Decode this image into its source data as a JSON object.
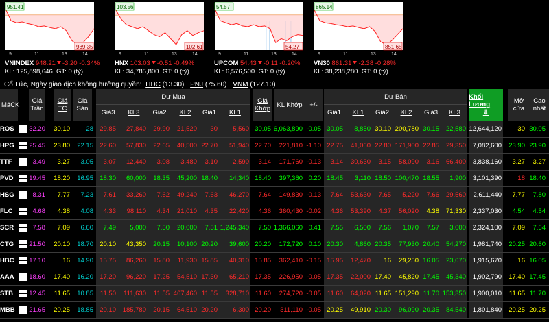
{
  "colors": {
    "up": "#00ff00",
    "down": "#ff2b2b",
    "ref": "#ffff00",
    "ceil": "#ff40ff",
    "floor": "#00cccc",
    "white": "#ffffff"
  },
  "indices": [
    {
      "name": "VNINDEX",
      "value": "948.21",
      "change": "-3.20",
      "pct": "-0.34%",
      "kl_label": "KL:",
      "kl": "125,898,646",
      "gt_label": "GT:",
      "gt": "0 (tỷ)",
      "high_label": "951.41",
      "low_label": "939.35",
      "xticks": [
        "9",
        "11",
        "13",
        "14"
      ]
    },
    {
      "name": "HNX",
      "value": "103.03",
      "change": "-0.51",
      "pct": "-0.49%",
      "kl_label": "KL:",
      "kl": "34,785,800",
      "gt_label": "GT:",
      "gt": "0 (tỷ)",
      "high_label": "103.56",
      "low_label": "102.61",
      "xticks": [
        "9",
        "11",
        "13",
        "14"
      ]
    },
    {
      "name": "UPCOM",
      "value": "54.43",
      "change": "-0.11",
      "pct": "-0.20%",
      "kl_label": "KL:",
      "kl": "6,576,500",
      "gt_label": "GT:",
      "gt": "0 (tỷ)",
      "high_label": "54.57",
      "low_label": "54.27",
      "xticks": [
        "9",
        "11",
        "13",
        "14"
      ]
    },
    {
      "name": "VN30",
      "value": "861.31",
      "change": "-2.38",
      "pct": "-0.28%",
      "kl_label": "KL:",
      "kl": "38,238,280",
      "gt_label": "GT:",
      "gt": "0 (tỷ)",
      "high_label": "865.14",
      "low_label": "851.65",
      "xticks": [
        "9",
        "11",
        "13",
        "14"
      ]
    }
  ],
  "dividend": {
    "text": "Cổ Tức, Ngày giao dịch không hưởng quyền:",
    "items": [
      {
        "code": "HDC",
        "val": "(13.30)"
      },
      {
        "code": "PNJ",
        "val": "(75.60)"
      },
      {
        "code": "VNM",
        "val": "(127.10)"
      }
    ]
  },
  "headers": {
    "mack": "MãCK",
    "tran": "Giá Trần",
    "tc": "Giá TC",
    "san": "Giá Sàn",
    "du_mua": "Dư Mua",
    "du_ban": "Dư Bán",
    "gia3": "Giá3",
    "kl3": "KL3",
    "gia2": "Giá2",
    "kl2": "KL2",
    "gia1": "Giá1",
    "kl1": "KL1",
    "gia_khop": "Giá Khớp",
    "kl_khop": "KL Khớp",
    "pm": "+/-",
    "khoi_luong": "Khối Lương",
    "sort": "⇓",
    "mo_cua": "Mở cửa",
    "cao_nhat": "Cao nhất"
  },
  "rows": [
    {
      "sym": "ROS",
      "c": [
        "32.20",
        "30.10",
        "28",
        "29.85",
        "27,840",
        "29.90",
        "21,520",
        "30",
        "5,560",
        "30.05",
        "6,063,890",
        "-0.05",
        "30.05",
        "8,850",
        "30.10",
        "200,780",
        "30.15",
        "22,580",
        "12,644,120",
        "30",
        "30.05"
      ],
      "k": [
        "C",
        "R",
        "F",
        "D",
        "D",
        "D",
        "D",
        "D",
        "D",
        "U",
        "U",
        "U",
        "U",
        "U",
        "R",
        "R",
        "U",
        "U",
        "W",
        "R",
        "U"
      ]
    },
    {
      "sym": "HPG",
      "c": [
        "25.45",
        "23.80",
        "22.15",
        "22.60",
        "57,830",
        "22.65",
        "40,500",
        "22.70",
        "51,940",
        "22.70",
        "221,810",
        "-1.10",
        "22.75",
        "41,060",
        "22.80",
        "171,900",
        "22.85",
        "29,350",
        "7,082,600",
        "23.90",
        "23.90"
      ],
      "k": [
        "C",
        "R",
        "F",
        "D",
        "D",
        "D",
        "D",
        "D",
        "D",
        "D",
        "D",
        "D",
        "D",
        "D",
        "D",
        "D",
        "D",
        "D",
        "W",
        "U",
        "U"
      ]
    },
    {
      "sym": "TTF",
      "c": [
        "3.49",
        "3.27",
        "3.05",
        "3.07",
        "12,440",
        "3.08",
        "3,480",
        "3.10",
        "2,590",
        "3.14",
        "171,760",
        "-0.13",
        "3.14",
        "30,630",
        "3.15",
        "58,090",
        "3.16",
        "66,400",
        "3,838,160",
        "3.27",
        "3.27"
      ],
      "k": [
        "C",
        "R",
        "F",
        "D",
        "D",
        "D",
        "D",
        "D",
        "D",
        "D",
        "D",
        "D",
        "D",
        "D",
        "D",
        "D",
        "D",
        "D",
        "W",
        "R",
        "R"
      ]
    },
    {
      "sym": "PVD",
      "c": [
        "19.45",
        "18.20",
        "16.95",
        "18.30",
        "60,000",
        "18.35",
        "45,200",
        "18.40",
        "14,340",
        "18.40",
        "397,360",
        "0.20",
        "18.45",
        "3,110",
        "18.50",
        "100,470",
        "18.55",
        "1,900",
        "3,101,390",
        "18",
        "18.40"
      ],
      "k": [
        "C",
        "R",
        "F",
        "U",
        "U",
        "U",
        "U",
        "U",
        "U",
        "U",
        "U",
        "U",
        "U",
        "U",
        "U",
        "U",
        "U",
        "U",
        "W",
        "D",
        "U"
      ]
    },
    {
      "sym": "HSG",
      "c": [
        "8.31",
        "7.77",
        "7.23",
        "7.61",
        "33,260",
        "7.62",
        "49,240",
        "7.63",
        "46,270",
        "7.64",
        "149,830",
        "-0.13",
        "7.64",
        "53,630",
        "7.65",
        "5,220",
        "7.66",
        "29,560",
        "2,611,440",
        "7.77",
        "7.80"
      ],
      "k": [
        "C",
        "R",
        "F",
        "D",
        "D",
        "D",
        "D",
        "D",
        "D",
        "D",
        "D",
        "D",
        "D",
        "D",
        "D",
        "D",
        "D",
        "D",
        "W",
        "R",
        "U"
      ]
    },
    {
      "sym": "FLC",
      "c": [
        "4.68",
        "4.38",
        "4.08",
        "4.33",
        "98,110",
        "4.34",
        "21,010",
        "4.35",
        "22,420",
        "4.36",
        "360,430",
        "-0.02",
        "4.36",
        "53,390",
        "4.37",
        "56,020",
        "4.38",
        "71,330",
        "2,337,030",
        "4.54",
        "4.54"
      ],
      "k": [
        "C",
        "R",
        "F",
        "D",
        "D",
        "D",
        "D",
        "D",
        "D",
        "D",
        "D",
        "D",
        "D",
        "D",
        "D",
        "D",
        "R",
        "R",
        "W",
        "U",
        "U"
      ]
    },
    {
      "sym": "SCR",
      "c": [
        "7.58",
        "7.09",
        "6.60",
        "7.49",
        "5,000",
        "7.50",
        "20,000",
        "7.51",
        "1,245,340",
        "7.50",
        "1,366,060",
        "0.41",
        "7.55",
        "6,500",
        "7.56",
        "1,070",
        "7.57",
        "3,000",
        "2,324,100",
        "7.09",
        "7.64"
      ],
      "k": [
        "C",
        "R",
        "F",
        "U",
        "U",
        "U",
        "U",
        "U",
        "U",
        "U",
        "U",
        "U",
        "U",
        "U",
        "U",
        "U",
        "U",
        "U",
        "W",
        "R",
        "U"
      ]
    },
    {
      "sym": "CTG",
      "c": [
        "21.50",
        "20.10",
        "18.70",
        "20.10",
        "43,350",
        "20.15",
        "10,100",
        "20.20",
        "39,600",
        "20.20",
        "172,720",
        "0.10",
        "20.30",
        "4,860",
        "20.35",
        "77,930",
        "20.40",
        "54,270",
        "1,981,740",
        "20.25",
        "20.60"
      ],
      "k": [
        "C",
        "R",
        "F",
        "R",
        "R",
        "U",
        "U",
        "U",
        "U",
        "U",
        "U",
        "U",
        "U",
        "U",
        "U",
        "U",
        "U",
        "U",
        "W",
        "U",
        "U"
      ]
    },
    {
      "sym": "HBC",
      "c": [
        "17.10",
        "16",
        "14.90",
        "15.75",
        "86,260",
        "15.80",
        "11,930",
        "15.85",
        "40,310",
        "15.85",
        "362,410",
        "-0.15",
        "15.95",
        "12,470",
        "16",
        "29,250",
        "16.05",
        "23,070",
        "1,915,670",
        "16",
        "16.05"
      ],
      "k": [
        "C",
        "R",
        "F",
        "D",
        "D",
        "D",
        "D",
        "D",
        "D",
        "D",
        "D",
        "D",
        "D",
        "D",
        "R",
        "R",
        "U",
        "U",
        "W",
        "R",
        "U"
      ]
    },
    {
      "sym": "AAA",
      "c": [
        "18.60",
        "17.40",
        "16.20",
        "17.20",
        "96,220",
        "17.25",
        "54,510",
        "17.30",
        "65,210",
        "17.35",
        "226,950",
        "-0.05",
        "17.35",
        "22,000",
        "17.40",
        "45,820",
        "17.45",
        "45,340",
        "1,902,790",
        "17.40",
        "17.45"
      ],
      "k": [
        "C",
        "R",
        "F",
        "D",
        "D",
        "D",
        "D",
        "D",
        "D",
        "D",
        "D",
        "D",
        "D",
        "D",
        "R",
        "R",
        "U",
        "U",
        "W",
        "R",
        "U"
      ]
    },
    {
      "sym": "STB",
      "c": [
        "12.45",
        "11.65",
        "10.85",
        "11.50",
        "111,630",
        "11.55",
        "467,460",
        "11.55",
        "328,710",
        "11.60",
        "274,720",
        "-0.05",
        "11.60",
        "64,020",
        "11.65",
        "151,290",
        "11.70",
        "153,350",
        "1,900,010",
        "11.65",
        "11.70"
      ],
      "k": [
        "C",
        "R",
        "F",
        "D",
        "D",
        "D",
        "D",
        "D",
        "D",
        "D",
        "D",
        "D",
        "D",
        "D",
        "R",
        "R",
        "U",
        "U",
        "W",
        "R",
        "U"
      ]
    },
    {
      "sym": "MBB",
      "c": [
        "21.65",
        "20.25",
        "18.85",
        "20.10",
        "185,780",
        "20.15",
        "64,510",
        "20.20",
        "6,300",
        "20.20",
        "311,110",
        "-0.05",
        "20.25",
        "49,910",
        "20.30",
        "96,090",
        "20.35",
        "84,540",
        "1,801,840",
        "20.25",
        "20.25"
      ],
      "k": [
        "C",
        "R",
        "F",
        "D",
        "D",
        "D",
        "D",
        "D",
        "D",
        "D",
        "D",
        "D",
        "R",
        "R",
        "U",
        "U",
        "U",
        "U",
        "W",
        "R",
        "R"
      ]
    }
  ]
}
